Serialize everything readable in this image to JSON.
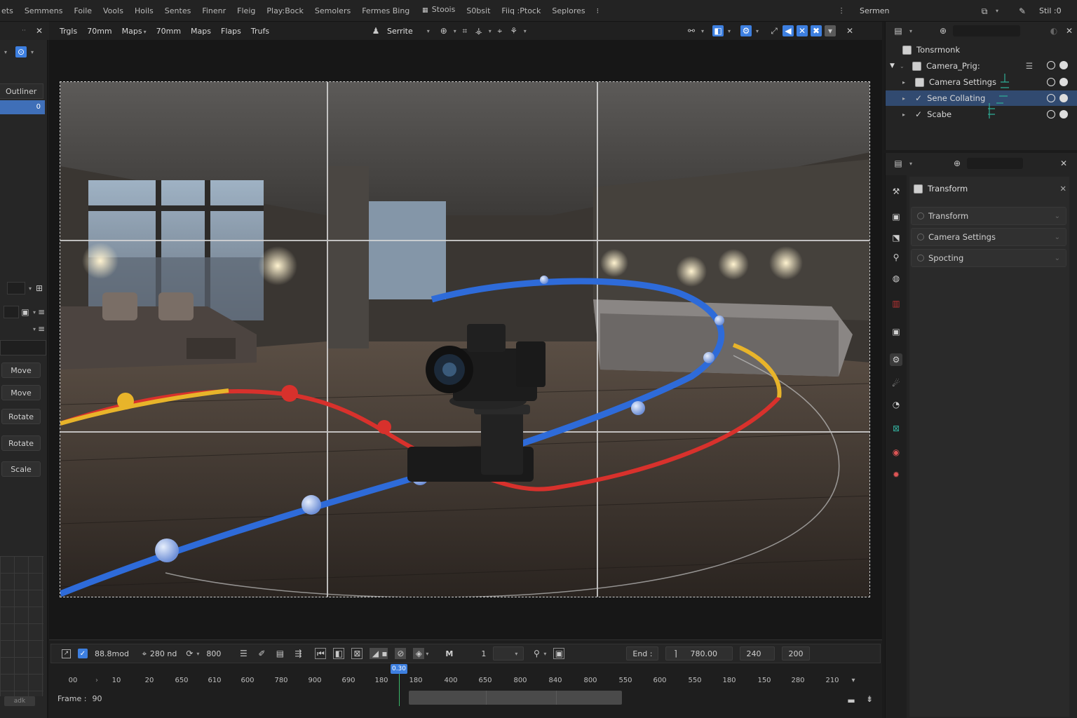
{
  "menubar": {
    "items": [
      "ets",
      "Semmens",
      "Foile",
      "Vools",
      "Hoils",
      "Sentes",
      "Finenr",
      "Fleig",
      "Play:Bock",
      "Semolers",
      "Fermes Bing",
      "Stoois",
      "S0bsit",
      "Fiiq :Ptock",
      "Seplores"
    ],
    "right_label": "Sermen",
    "right_user": "Stil :0"
  },
  "left": {
    "outliner_label": "Outliner",
    "outliner_selected": "0",
    "tools": [
      "Move",
      "Move",
      "Rotate",
      "Rotate",
      "Scale"
    ],
    "footer": "adk"
  },
  "viewport_header": {
    "items": [
      "Trgls",
      "70mm",
      "Maps",
      "70mm",
      "Maps",
      "Flaps",
      "Trufs"
    ],
    "shading_label": "Serrite"
  },
  "timeline": {
    "start_value": "88.8mod",
    "end_value": "280 nd",
    "rate_value": "800",
    "mode_label": "M",
    "current_frame": "1",
    "end_label": "End :",
    "end_frame_value": "780.00",
    "step_value": "240",
    "total_value": "200",
    "ruler": [
      "00",
      "10",
      "20",
      "650",
      "610",
      "600",
      "780",
      "900",
      "690",
      "180",
      "180",
      "400",
      "650",
      "800",
      "840",
      "800",
      "550",
      "600",
      "550",
      "180",
      "150",
      "280",
      "210"
    ],
    "playhead_label": "0.30",
    "frame_label": "Frame :",
    "frame_value": "90"
  },
  "outliner": {
    "items": [
      {
        "label": "Tonsrmonk"
      },
      {
        "label": "Camera_Prig:"
      },
      {
        "label": "Camera Settings"
      },
      {
        "label": "Sene Collating"
      },
      {
        "label": "Scabe"
      }
    ]
  },
  "properties": {
    "title": "Transform",
    "sections": [
      "Transform",
      "Camera Settings",
      "Spocting"
    ]
  },
  "colors": {
    "accent": "#3d7fe0",
    "selection": "#314a70",
    "curve_blue": "#2e6bd9",
    "curve_red": "#d8312c",
    "curve_yellow": "#e8b42a",
    "playhead": "#3ab86a"
  }
}
